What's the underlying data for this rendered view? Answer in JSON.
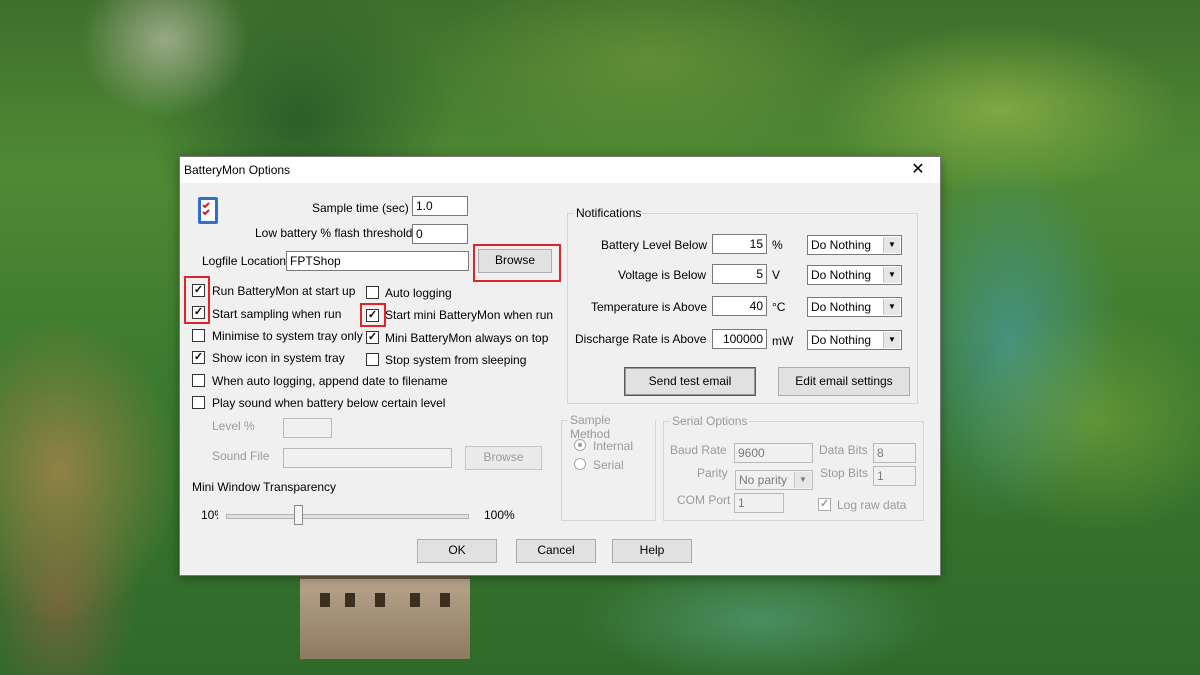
{
  "window": {
    "title": "BatteryMon Options",
    "close_glyph": "✕"
  },
  "left": {
    "sample_time_label": "Sample time (sec)",
    "sample_time_value": "1.0",
    "low_battery_label": "Low battery % flash threshold",
    "low_battery_value": "0",
    "logfile_label": "Logfile Location",
    "logfile_value": "FPTShop",
    "browse_label": "Browse",
    "options": {
      "run_at_startup": {
        "label": "Run BatteryMon at start up",
        "checked": true
      },
      "start_sampling": {
        "label": "Start sampling when run",
        "checked": true
      },
      "minimise_tray": {
        "label": "Minimise to system tray only",
        "checked": false
      },
      "show_icon": {
        "label": "Show icon in system tray",
        "checked": true
      },
      "append_date": {
        "label": "When auto logging, append date to filename",
        "checked": false
      },
      "play_sound": {
        "label": "Play sound when battery below certain level",
        "checked": false
      },
      "auto_logging": {
        "label": "Auto logging",
        "checked": false
      },
      "start_mini": {
        "label": "Start mini BatteryMon when run",
        "checked": true
      },
      "mini_on_top": {
        "label": "Mini BatteryMon always on top",
        "checked": true
      },
      "stop_sleeping": {
        "label": "Stop system from sleeping",
        "checked": false
      }
    },
    "level_label": "Level %",
    "sound_file_label": "Sound File",
    "sound_browse_label": "Browse",
    "transparency_label": "Mini Window Transparency",
    "transparency_min": "10%",
    "transparency_max": "100%",
    "transparency_level": 0.3
  },
  "notifications": {
    "legend": "Notifications",
    "rows": [
      {
        "label": "Battery Level Below",
        "value": "15",
        "unit": "%",
        "action": "Do Nothing"
      },
      {
        "label": "Voltage is Below",
        "value": "5",
        "unit": "V",
        "action": "Do Nothing"
      },
      {
        "label": "Temperature is Above",
        "value": "40",
        "unit": "°C",
        "action": "Do Nothing"
      },
      {
        "label": "Discharge Rate is Above",
        "value": "100000",
        "unit": "mW",
        "action": "Do Nothing"
      }
    ],
    "send_test_email": "Send test email",
    "edit_email_settings": "Edit email settings"
  },
  "sample_method": {
    "legend": "Sample Method",
    "internal": "Internal",
    "serial": "Serial",
    "selected": "Internal"
  },
  "serial_options": {
    "legend": "Serial Options",
    "baud_rate_label": "Baud Rate",
    "baud_rate_value": "9600",
    "data_bits_label": "Data Bits",
    "data_bits_value": "8",
    "parity_label": "Parity",
    "parity_value": "No parity",
    "stop_bits_label": "Stop Bits",
    "stop_bits_value": "1",
    "com_port_label": "COM Port",
    "com_port_value": "1",
    "log_raw_label": "Log raw data",
    "log_raw_checked": true
  },
  "footer": {
    "ok": "OK",
    "cancel": "Cancel",
    "help": "Help"
  }
}
